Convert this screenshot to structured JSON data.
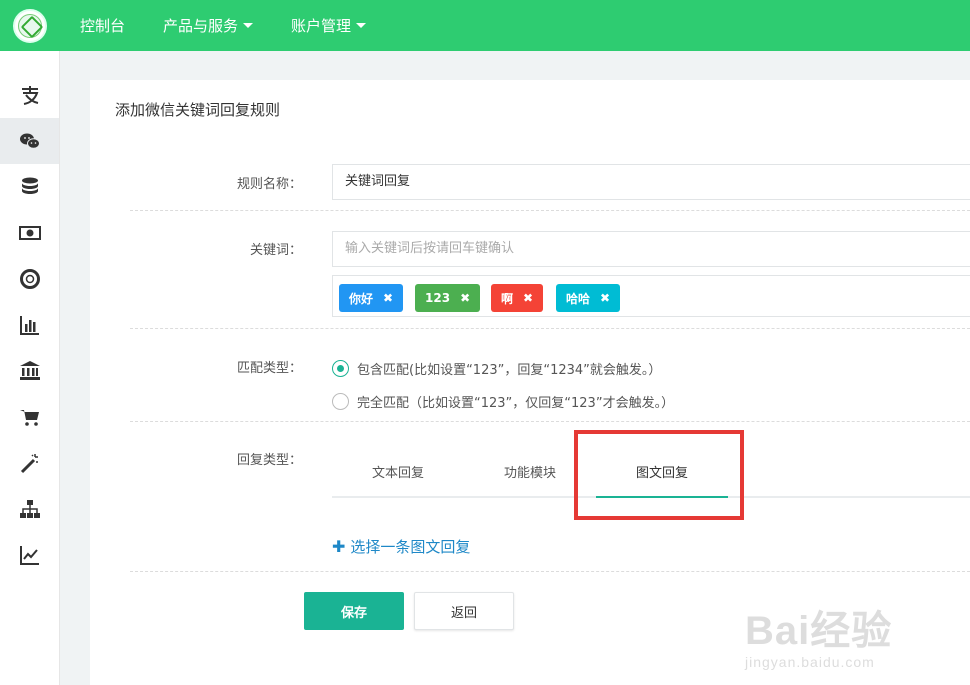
{
  "nav": {
    "items": [
      {
        "label": "控制台",
        "has_caret": false
      },
      {
        "label": "产品与服务",
        "has_caret": true
      },
      {
        "label": "账户管理",
        "has_caret": true
      }
    ],
    "bg_color": "#2ecc71"
  },
  "sidebar": {
    "items": [
      {
        "icon": "alipay-icon",
        "active": false
      },
      {
        "icon": "wechat-icon",
        "active": true
      },
      {
        "icon": "database-icon",
        "active": false
      },
      {
        "icon": "money-icon",
        "active": false
      },
      {
        "icon": "lifebuoy-icon",
        "active": false
      },
      {
        "icon": "bar-chart-icon",
        "active": false
      },
      {
        "icon": "bank-icon",
        "active": false
      },
      {
        "icon": "cart-icon",
        "active": false
      },
      {
        "icon": "magic-wand-icon",
        "active": false
      },
      {
        "icon": "sitemap-icon",
        "active": false
      },
      {
        "icon": "line-chart-icon",
        "active": false
      }
    ]
  },
  "page": {
    "title": "添加微信关键词回复规则"
  },
  "form": {
    "rule_name_label": "规则名称：",
    "rule_name_value": "关键词回复",
    "keyword_label": "关键词：",
    "keyword_placeholder": "输入关键词后按请回车键确认",
    "tags": [
      {
        "label": "你好",
        "color": "#2196f3"
      },
      {
        "label": "123",
        "color": "#4caf50"
      },
      {
        "label": "啊",
        "color": "#f44336"
      },
      {
        "label": "哈哈",
        "color": "#00bcd4"
      }
    ],
    "match_label": "匹配类型：",
    "match_options": [
      {
        "label": "包含匹配(比如设置“123”，回复“1234”就会触发。）",
        "checked": true
      },
      {
        "label": "完全匹配（比如设置“123”，仅回复“123”才会触发。）",
        "checked": false
      }
    ],
    "reply_label": "回复类型：",
    "reply_tabs": [
      {
        "label": "文本回复",
        "active": false
      },
      {
        "label": "功能模块",
        "active": false
      },
      {
        "label": "图文回复",
        "active": true
      }
    ],
    "select_link": "选择一条图文回复",
    "save_label": "保存",
    "back_label": "返回"
  },
  "watermark": {
    "line1": "Bai经验",
    "line2": "jingyan.baidu.com"
  },
  "colors": {
    "accent": "#1ab394",
    "highlight": "#e53935",
    "link": "#1e88c7"
  }
}
